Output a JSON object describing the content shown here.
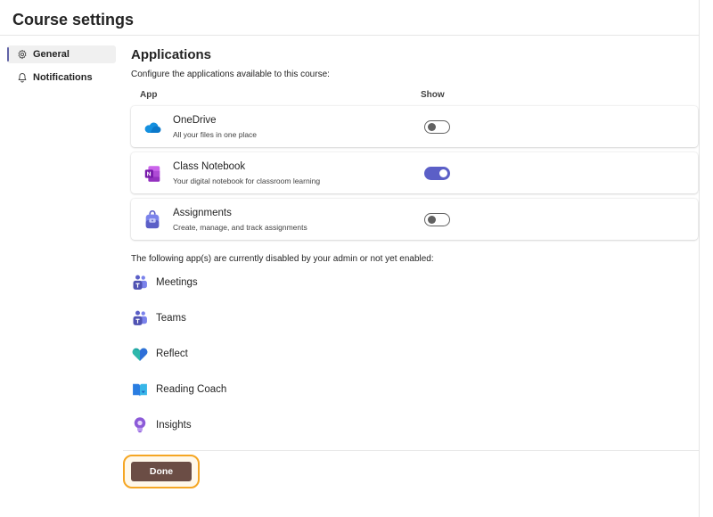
{
  "page": {
    "title": "Course settings"
  },
  "sidebar": {
    "items": [
      {
        "label": "General",
        "icon": "gear-icon",
        "active": true
      },
      {
        "label": "Notifications",
        "icon": "bell-icon",
        "active": false
      }
    ]
  },
  "applications": {
    "title": "Applications",
    "description": "Configure the applications available to this course:",
    "col_app": "App",
    "col_show": "Show",
    "apps": [
      {
        "name": "OneDrive",
        "desc": "All your files in one place",
        "icon": "onedrive-icon",
        "show": false
      },
      {
        "name": "Class Notebook",
        "desc": "Your digital notebook for classroom learning",
        "icon": "onenote-icon",
        "show": true
      },
      {
        "name": "Assignments",
        "desc": "Create, manage, and track assignments",
        "icon": "assignments-icon",
        "show": false
      }
    ]
  },
  "disabled": {
    "note": "The following app(s) are currently disabled by your admin or not yet enabled:",
    "items": [
      {
        "label": "Meetings",
        "icon": "meetings-icon"
      },
      {
        "label": "Teams",
        "icon": "teams-icon"
      },
      {
        "label": "Reflect",
        "icon": "reflect-icon"
      },
      {
        "label": "Reading Coach",
        "icon": "reading-coach-icon"
      },
      {
        "label": "Insights",
        "icon": "insights-icon"
      }
    ]
  },
  "footer": {
    "done_label": "Done"
  },
  "colors": {
    "accent": "#5b5fc7",
    "done_button": "#6b4d45",
    "focus_ring": "#f5a623"
  }
}
